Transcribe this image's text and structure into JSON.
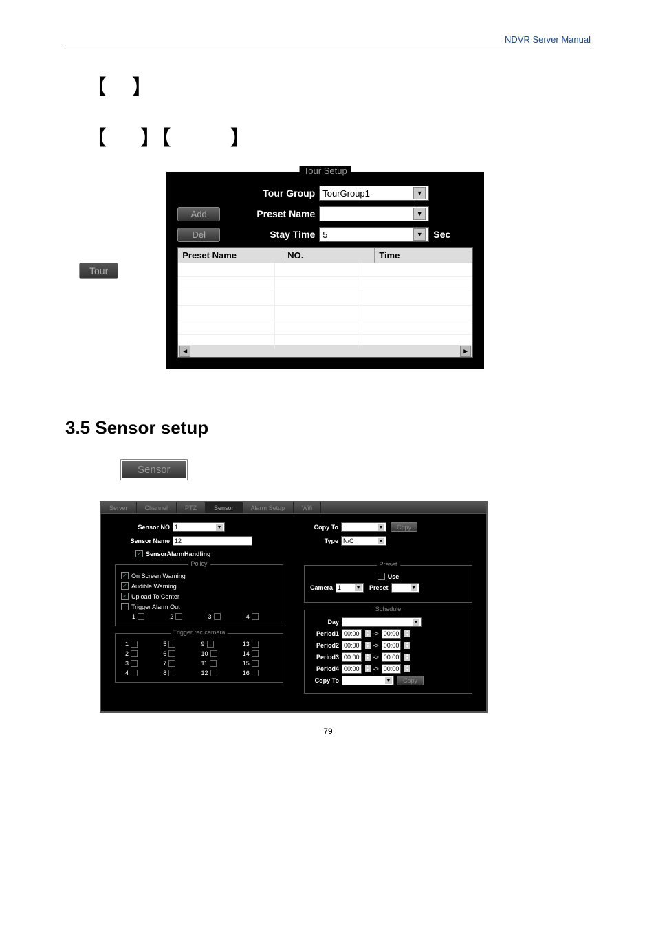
{
  "header": {
    "right_text": "NDVR Server Manual"
  },
  "brackets": {
    "line1_gap": "",
    "line2_gap1": "",
    "line2_gap2": ""
  },
  "tour_button": "Tour",
  "tour_setup": {
    "title": "Tour Setup",
    "add": "Add",
    "del": "Del",
    "tour_group_label": "Tour Group",
    "tour_group_value": "TourGroup1",
    "preset_name_label": "Preset Name",
    "preset_name_value": "",
    "stay_time_label": "Stay Time",
    "stay_time_value": "5",
    "sec": "Sec",
    "cols": {
      "c1": "Preset Name",
      "c2": "NO.",
      "c3": "Time"
    }
  },
  "section_title": "3.5 Sensor setup",
  "sensor_button": "Sensor",
  "sensor_panel": {
    "tabs": [
      "Server",
      "Channel",
      "PTZ",
      "Sensor",
      "Alarm Setup",
      "Wifi"
    ],
    "active_tab": 3,
    "sensor_no_label": "Sensor NO",
    "sensor_no_value": "1",
    "sensor_name_label": "Sensor Name",
    "sensor_name_value": "12",
    "sensor_alarm_handling": "SensorAlarmHandling",
    "copy_to_label": "Copy To",
    "copy_to_value": "",
    "copy_btn": "Copy",
    "type_label": "Type",
    "type_value": "N/C",
    "policy": {
      "legend": "Policy",
      "items": [
        {
          "label": "On Screen Warning",
          "checked": true
        },
        {
          "label": "Audible Warning",
          "checked": true
        },
        {
          "label": "Upload To Center",
          "checked": true
        },
        {
          "label": "Trigger Alarm Out",
          "checked": false
        }
      ],
      "alarm_out_nums": [
        "1",
        "2",
        "3",
        "4"
      ]
    },
    "trigger_rec": {
      "legend": "Trigger rec camera",
      "grid": [
        [
          "1",
          "5",
          "9",
          "13"
        ],
        [
          "2",
          "6",
          "10",
          "14"
        ],
        [
          "3",
          "7",
          "11",
          "15"
        ],
        [
          "4",
          "8",
          "12",
          "16"
        ]
      ]
    },
    "preset": {
      "legend": "Preset",
      "use": "Use",
      "camera_label": "Camera",
      "camera_value": "1",
      "preset_label": "Preset",
      "preset_value": ""
    },
    "schedule": {
      "legend": "Schedule",
      "day_label": "Day",
      "day_value": "",
      "periods": [
        {
          "label": "Period1",
          "from": "00:00",
          "to": "00:00"
        },
        {
          "label": "Period2",
          "from": "00:00",
          "to": "00:00"
        },
        {
          "label": "Period3",
          "from": "00:00",
          "to": "00:00"
        },
        {
          "label": "Period4",
          "from": "00:00",
          "to": "00:00"
        }
      ],
      "copy_to_label": "Copy To",
      "copy_to_value": "",
      "copy_btn": "Copy"
    }
  },
  "page_number": "79"
}
